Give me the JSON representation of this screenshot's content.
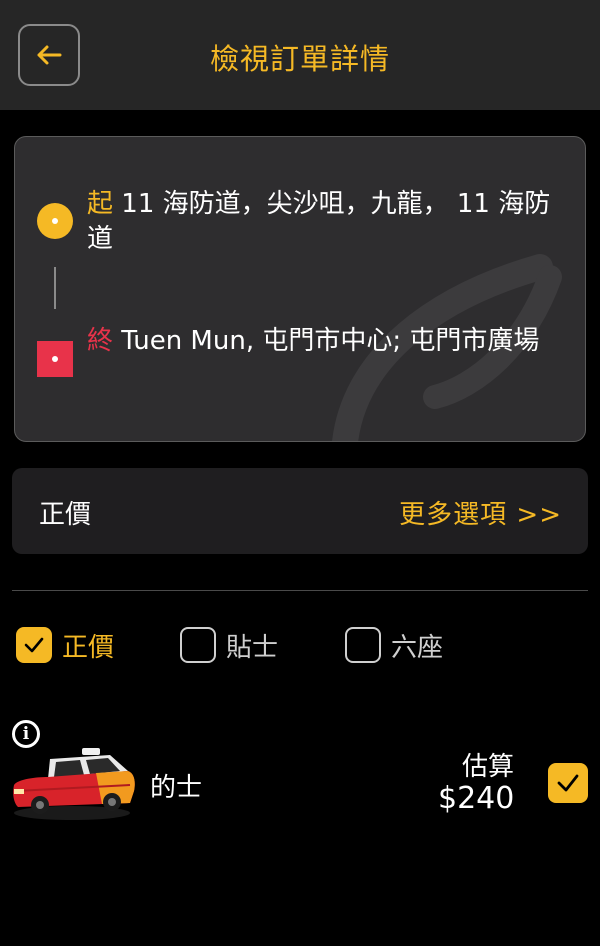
{
  "header": {
    "title": "檢視訂單詳情",
    "back_icon": "arrow-left-icon",
    "accent_color": "#f5b925"
  },
  "route": {
    "start_tag": "起",
    "start_address": "11 海防道，尖沙咀，九龍， 11 海防道",
    "end_tag": "終",
    "end_address": "Tuen Mun, 屯門市中心; 屯門市廣場",
    "start_color": "#f5b925",
    "end_color": "#e8334a"
  },
  "option_bar": {
    "label": "正價",
    "more_link": "更多選項 >>"
  },
  "filters": [
    {
      "label": "正價",
      "checked": true
    },
    {
      "label": "貼士",
      "checked": false
    },
    {
      "label": "六座",
      "checked": false
    }
  ],
  "vehicle": {
    "info_icon": "info-icon",
    "name": "的士",
    "estimate_label": "估算",
    "price": "$240",
    "selected": true
  }
}
